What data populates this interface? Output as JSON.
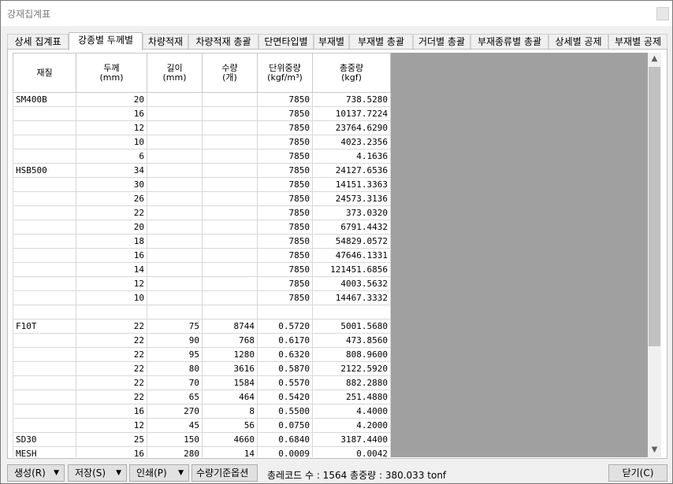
{
  "window": {
    "title": "강재집계표"
  },
  "tabs": [
    {
      "label": "상세 집계표"
    },
    {
      "label": "강종별 두께별",
      "active": true
    },
    {
      "label": "차량적재"
    },
    {
      "label": "차량적재 총괄"
    },
    {
      "label": "단면타입별"
    },
    {
      "label": "부재별"
    },
    {
      "label": "부재별 총괄"
    },
    {
      "label": "거더별 총괄"
    },
    {
      "label": "부재종류별 총괄"
    },
    {
      "label": "상세별 공제"
    },
    {
      "label": "부재별 공제"
    }
  ],
  "table": {
    "headers": [
      {
        "line1": "재질",
        "line2": ""
      },
      {
        "line1": "두께",
        "line2": "(mm)"
      },
      {
        "line1": "길이",
        "line2": "(mm)"
      },
      {
        "line1": "수량",
        "line2": "(개)"
      },
      {
        "line1": "단위중량",
        "line2": "(kgf/m³)"
      },
      {
        "line1": "총중량",
        "line2": "(kgf)"
      }
    ],
    "rows": [
      [
        "SM400B",
        "20",
        "",
        "",
        "7850",
        "738.5280"
      ],
      [
        "",
        "16",
        "",
        "",
        "7850",
        "10137.7224"
      ],
      [
        "",
        "12",
        "",
        "",
        "7850",
        "23764.6290"
      ],
      [
        "",
        "10",
        "",
        "",
        "7850",
        "4023.2356"
      ],
      [
        "",
        "6",
        "",
        "",
        "7850",
        "4.1636"
      ],
      [
        "HSB500",
        "34",
        "",
        "",
        "7850",
        "24127.6536"
      ],
      [
        "",
        "30",
        "",
        "",
        "7850",
        "14151.3363"
      ],
      [
        "",
        "26",
        "",
        "",
        "7850",
        "24573.3136"
      ],
      [
        "",
        "22",
        "",
        "",
        "7850",
        "373.0320"
      ],
      [
        "",
        "20",
        "",
        "",
        "7850",
        "6791.4432"
      ],
      [
        "",
        "18",
        "",
        "",
        "7850",
        "54829.0572"
      ],
      [
        "",
        "16",
        "",
        "",
        "7850",
        "47646.1331"
      ],
      [
        "",
        "14",
        "",
        "",
        "7850",
        "121451.6856"
      ],
      [
        "",
        "12",
        "",
        "",
        "7850",
        "4003.5632"
      ],
      [
        "",
        "10",
        "",
        "",
        "7850",
        "14467.3332"
      ],
      [
        "",
        "",
        "",
        "",
        "",
        ""
      ],
      [
        "F10T",
        "22",
        "75",
        "8744",
        "0.5720",
        "5001.5680"
      ],
      [
        "",
        "22",
        "90",
        "768",
        "0.6170",
        "473.8560"
      ],
      [
        "",
        "22",
        "95",
        "1280",
        "0.6320",
        "808.9600"
      ],
      [
        "",
        "22",
        "80",
        "3616",
        "0.5870",
        "2122.5920"
      ],
      [
        "",
        "22",
        "70",
        "1584",
        "0.5570",
        "882.2880"
      ],
      [
        "",
        "22",
        "65",
        "464",
        "0.5420",
        "251.4880"
      ],
      [
        "",
        "16",
        "270",
        "8",
        "0.5500",
        "4.4000"
      ],
      [
        "",
        "12",
        "45",
        "56",
        "0.0750",
        "4.2000"
      ],
      [
        "SD30",
        "25",
        "150",
        "4660",
        "0.6840",
        "3187.4400"
      ],
      [
        "MESH",
        "16",
        "280",
        "14",
        "0.0009",
        "0.0042"
      ]
    ]
  },
  "buttons": {
    "generate": "생성(R)",
    "save": "저장(S)",
    "print": "인쇄(P)",
    "qty_option": "수량기준옵션",
    "close": "닫기(C)"
  },
  "status": {
    "text": "총레코드 수 : 1564 총중량 : 380.033 tonf"
  },
  "icons": {
    "scroll_up": "chevron-up-icon",
    "scroll_down": "chevron-down-icon",
    "dropdown": "triangle-down-icon"
  }
}
